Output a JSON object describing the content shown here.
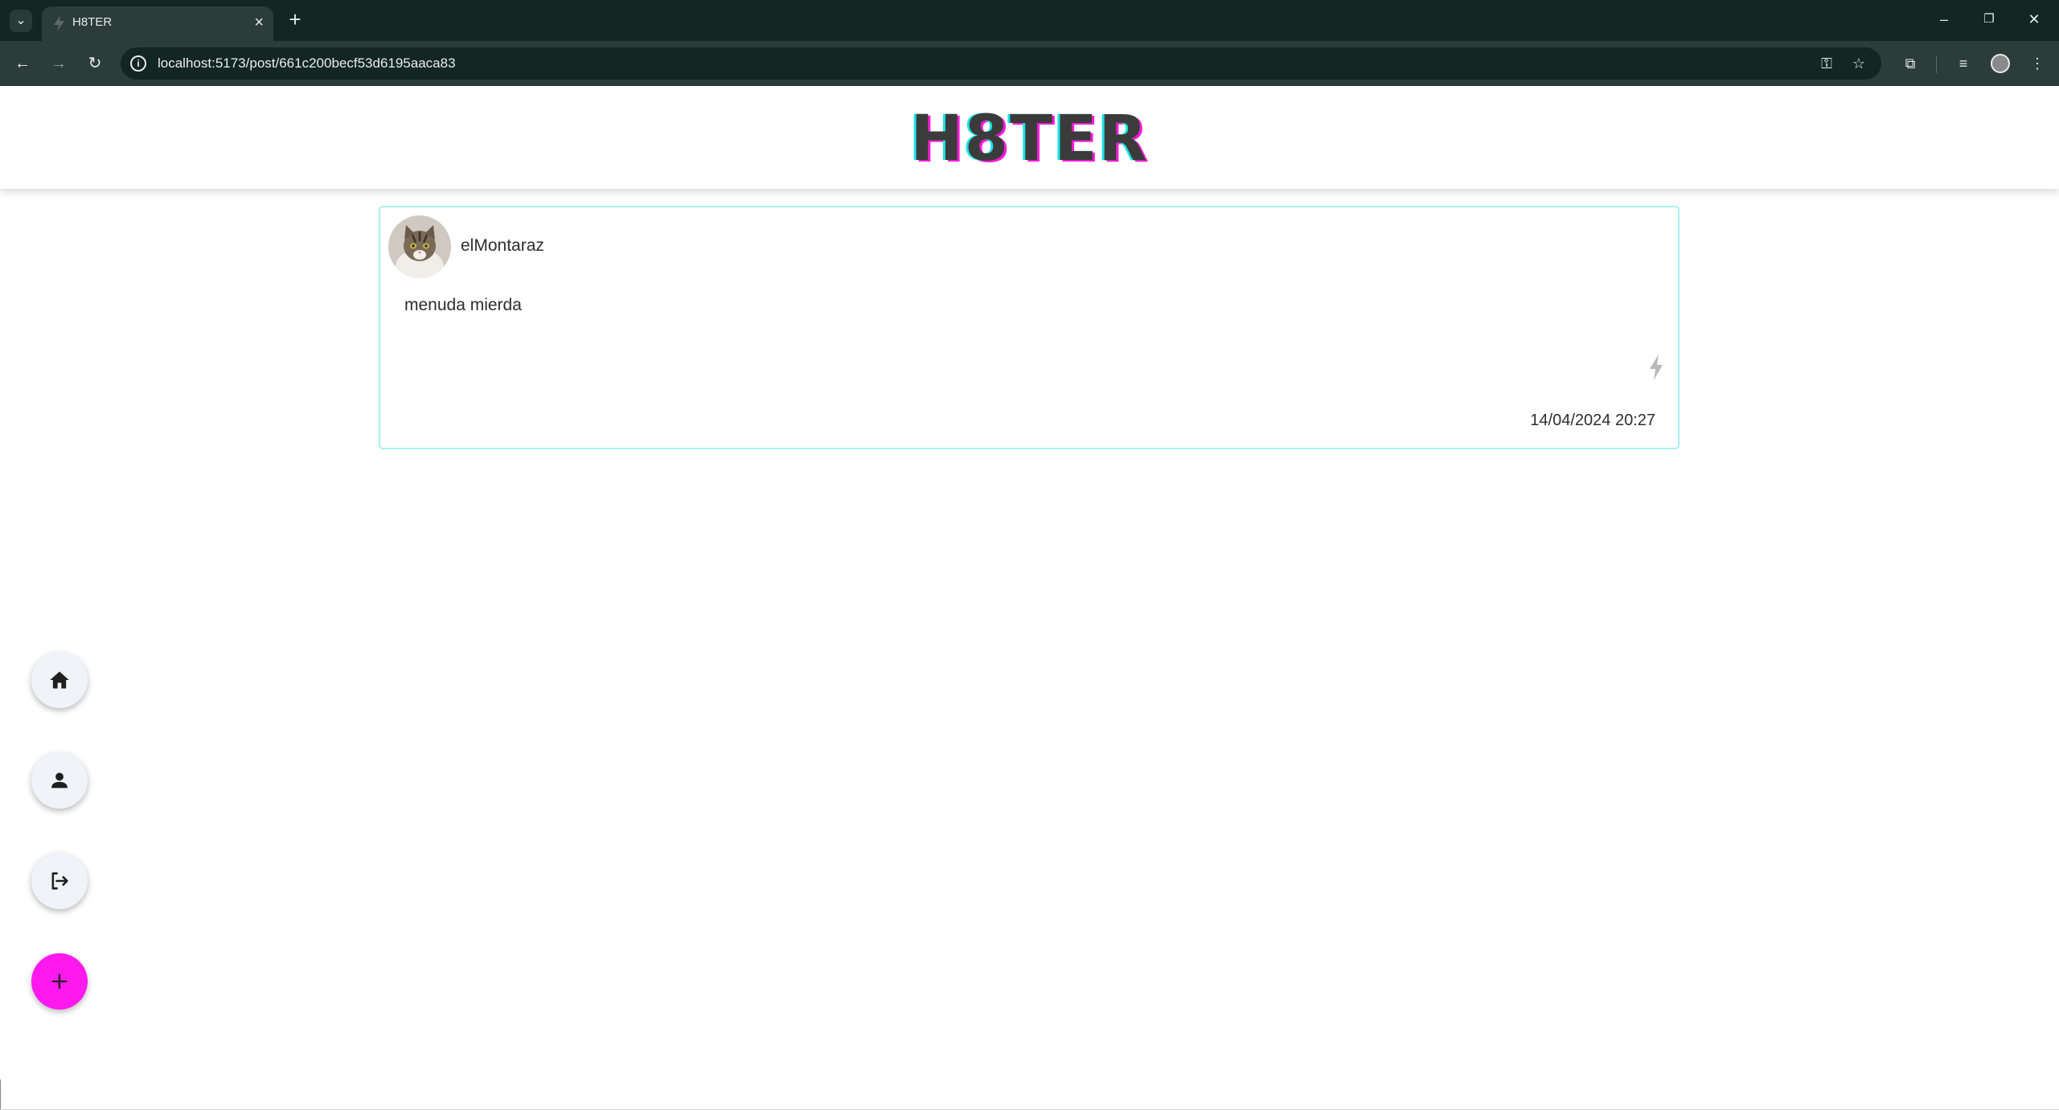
{
  "browser": {
    "tab_title": "H8TER",
    "url": "localhost:5173/post/661c200becf53d6195aaca83",
    "new_tab_label": "+",
    "tab_close_label": "×"
  },
  "app": {
    "logo": "H8TER"
  },
  "post": {
    "username": "elMontaraz",
    "text": "menuda mierda",
    "timestamp": "14/04/2024 20:27",
    "avatar": "cat-photo"
  },
  "nav_buttons": [
    {
      "name": "home",
      "icon": "home-icon"
    },
    {
      "name": "profile",
      "icon": "person-icon"
    },
    {
      "name": "logout",
      "icon": "logout-icon"
    },
    {
      "name": "new-post",
      "icon": "plus-icon"
    }
  ],
  "colors": {
    "accent_cyan": "#19e3e3",
    "accent_magenta": "#ff19ef",
    "card_border": "#aaf0f0",
    "chrome_dark": "#142622",
    "chrome_toolbar": "#2c3c38"
  }
}
